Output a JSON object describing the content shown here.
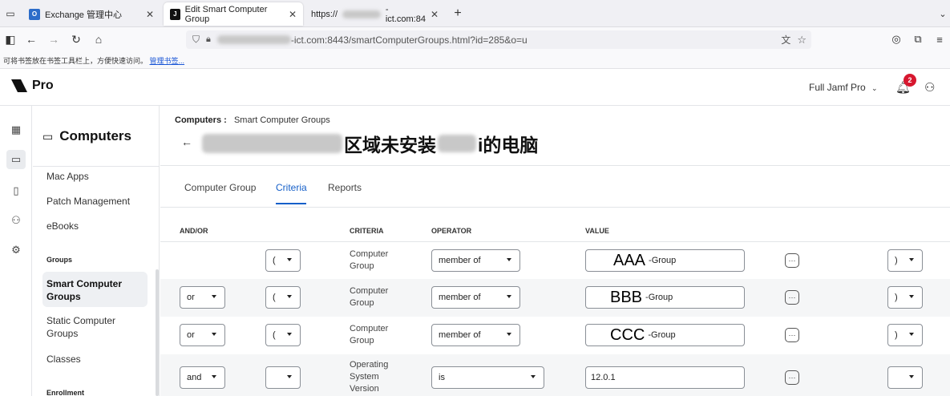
{
  "browser": {
    "tabs": [
      {
        "label": "Exchange 管理中心"
      },
      {
        "label": "Edit Smart Computer Group"
      },
      {
        "label": "https://"
      },
      {
        "label": "-ict.com:84"
      }
    ],
    "url_prefix": "-ict.com:8443/smartComputerGroups.html?id=285&o=u",
    "bookmarks_hint": "可将书签放在书签工具栏上，方便快速访问。",
    "bookmarks_link": "管理书签..."
  },
  "app": {
    "product": "Pro",
    "environment": "Full Jamf Pro",
    "notifications": "2"
  },
  "sidebar": {
    "section_title": "Computers",
    "items": [
      "Mac Apps",
      "Patch Management",
      "eBooks"
    ],
    "groups_label": "Groups",
    "group_items": [
      {
        "line1": "Smart Computer",
        "line2": "Groups"
      },
      {
        "line1": "Static Computer",
        "line2": "Groups"
      },
      {
        "line1": "Classes",
        "line2": ""
      }
    ],
    "enrollment_label": "Enrollment"
  },
  "main": {
    "breadcrumb_root": "Computers :",
    "breadcrumb_current": "Smart Computer Groups",
    "title_part1": "区域未安装",
    "title_part2": "i的电脑",
    "tabs": [
      "Computer Group",
      "Criteria",
      "Reports"
    ],
    "columns": {
      "andor": "AND/OR",
      "criteria": "CRITERIA",
      "operator": "OPERATOR",
      "value": "VALUE"
    }
  },
  "rows": [
    {
      "andor": "",
      "open": "(",
      "criteria": [
        "Computer",
        "Group"
      ],
      "operator": "member of",
      "value_big": "AAA",
      "value_small": "-Group",
      "close": ")"
    },
    {
      "andor": "or",
      "open": "(",
      "criteria": [
        "Computer",
        "Group"
      ],
      "operator": "member of",
      "value_big": "BBB",
      "value_small": "-Group",
      "close": ")"
    },
    {
      "andor": "or",
      "open": "(",
      "criteria": [
        "Computer",
        "Group"
      ],
      "operator": "member of",
      "value_big": "CCC",
      "value_small": "-Group",
      "close": ")"
    },
    {
      "andor": "and",
      "open": "",
      "criteria": [
        "Operating",
        "System",
        "Version"
      ],
      "operator": "is",
      "value_big": "",
      "value_small": "12.0.1",
      "close": ""
    }
  ],
  "icons": {
    "back": "arrow-left-icon",
    "more": "ellipsis-icon"
  }
}
